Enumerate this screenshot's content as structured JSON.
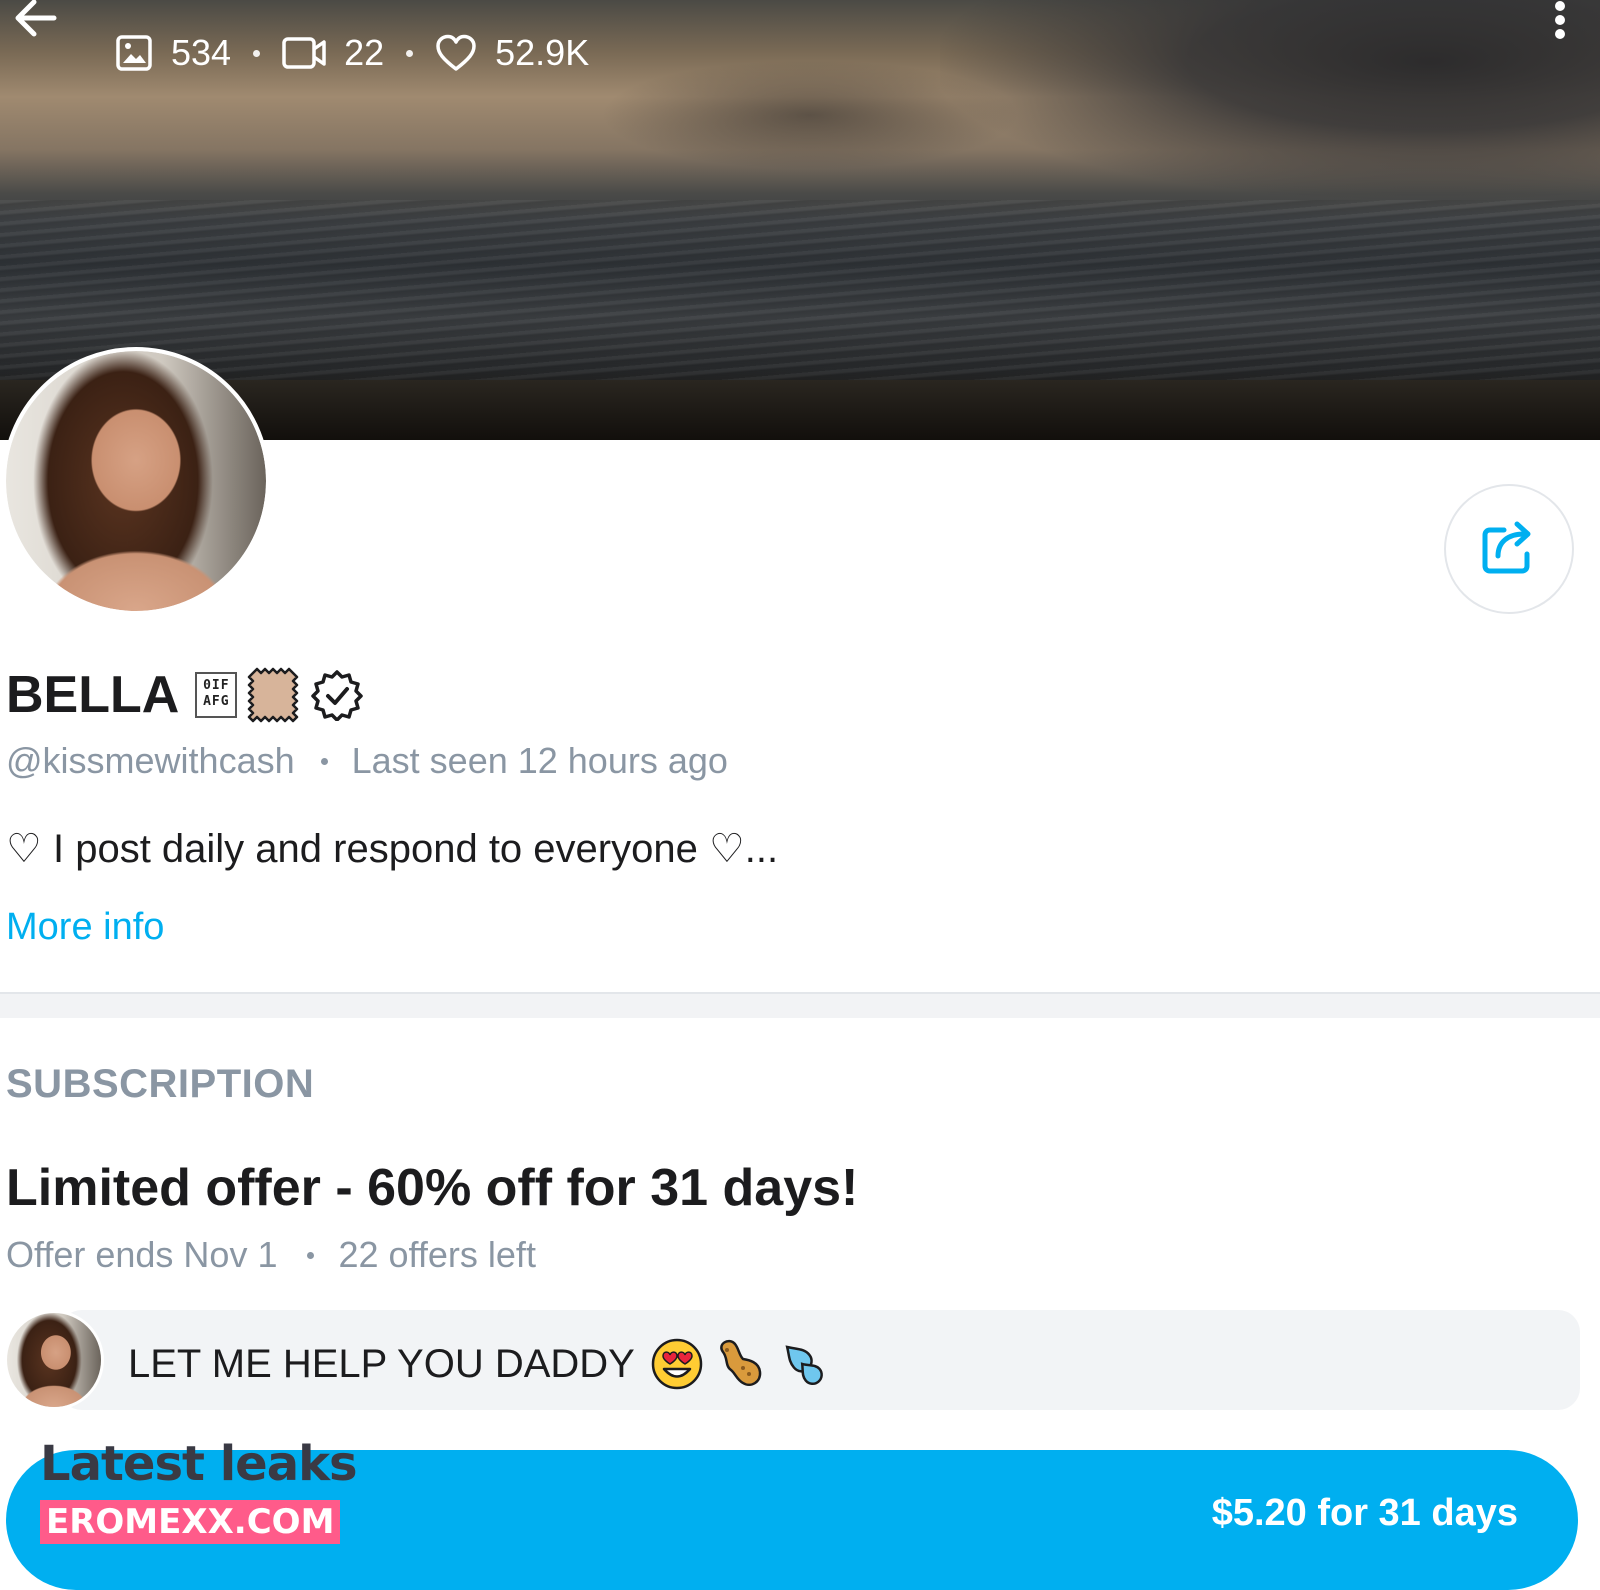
{
  "header": {
    "title": "BELLA",
    "back_icon": "arrow-left-icon",
    "menu_icon": "more-vertical-icon",
    "stats": {
      "photos": "534",
      "videos": "22",
      "likes": "52.9K"
    }
  },
  "profile": {
    "name": "BELLA",
    "qr_emoji_text": "0IF\nAFG",
    "handle": "@kissmewithcash",
    "last_seen": "Last seen 12 hours ago",
    "bio": "♡ I post daily and respond to everyone ♡...",
    "more_info": "More info"
  },
  "subscription": {
    "heading": "SUBSCRIPTION",
    "offer_title": "Limited offer - 60% off for 31 days!",
    "offer_ends": "Offer ends Nov 1",
    "offers_left": "22 offers left",
    "message": "LET ME HELP YOU DADDY",
    "price_label": "$5.20 for 31 days"
  },
  "watermark": {
    "title": "Latest leaks",
    "site": "EROMEXX.COM"
  },
  "colors": {
    "accent": "#00aff0",
    "muted": "#8a96a3",
    "text": "#1c1c1e",
    "watermark_pink": "#ff5b8a"
  }
}
